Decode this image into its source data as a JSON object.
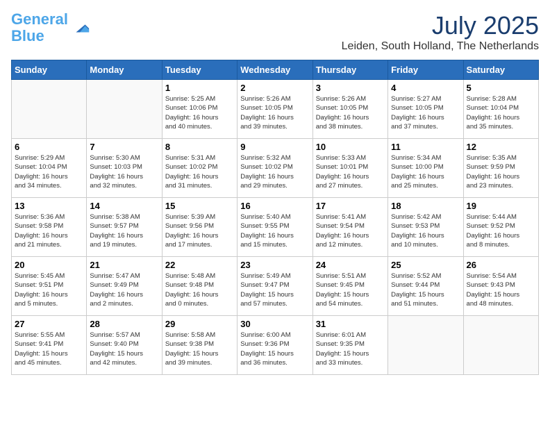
{
  "logo": {
    "line1": "General",
    "line2": "Blue"
  },
  "title": "July 2025",
  "location": "Leiden, South Holland, The Netherlands",
  "headers": [
    "Sunday",
    "Monday",
    "Tuesday",
    "Wednesday",
    "Thursday",
    "Friday",
    "Saturday"
  ],
  "weeks": [
    [
      {
        "day": "",
        "info": ""
      },
      {
        "day": "",
        "info": ""
      },
      {
        "day": "1",
        "info": "Sunrise: 5:25 AM\nSunset: 10:06 PM\nDaylight: 16 hours\nand 40 minutes."
      },
      {
        "day": "2",
        "info": "Sunrise: 5:26 AM\nSunset: 10:05 PM\nDaylight: 16 hours\nand 39 minutes."
      },
      {
        "day": "3",
        "info": "Sunrise: 5:26 AM\nSunset: 10:05 PM\nDaylight: 16 hours\nand 38 minutes."
      },
      {
        "day": "4",
        "info": "Sunrise: 5:27 AM\nSunset: 10:05 PM\nDaylight: 16 hours\nand 37 minutes."
      },
      {
        "day": "5",
        "info": "Sunrise: 5:28 AM\nSunset: 10:04 PM\nDaylight: 16 hours\nand 35 minutes."
      }
    ],
    [
      {
        "day": "6",
        "info": "Sunrise: 5:29 AM\nSunset: 10:04 PM\nDaylight: 16 hours\nand 34 minutes."
      },
      {
        "day": "7",
        "info": "Sunrise: 5:30 AM\nSunset: 10:03 PM\nDaylight: 16 hours\nand 32 minutes."
      },
      {
        "day": "8",
        "info": "Sunrise: 5:31 AM\nSunset: 10:02 PM\nDaylight: 16 hours\nand 31 minutes."
      },
      {
        "day": "9",
        "info": "Sunrise: 5:32 AM\nSunset: 10:02 PM\nDaylight: 16 hours\nand 29 minutes."
      },
      {
        "day": "10",
        "info": "Sunrise: 5:33 AM\nSunset: 10:01 PM\nDaylight: 16 hours\nand 27 minutes."
      },
      {
        "day": "11",
        "info": "Sunrise: 5:34 AM\nSunset: 10:00 PM\nDaylight: 16 hours\nand 25 minutes."
      },
      {
        "day": "12",
        "info": "Sunrise: 5:35 AM\nSunset: 9:59 PM\nDaylight: 16 hours\nand 23 minutes."
      }
    ],
    [
      {
        "day": "13",
        "info": "Sunrise: 5:36 AM\nSunset: 9:58 PM\nDaylight: 16 hours\nand 21 minutes."
      },
      {
        "day": "14",
        "info": "Sunrise: 5:38 AM\nSunset: 9:57 PM\nDaylight: 16 hours\nand 19 minutes."
      },
      {
        "day": "15",
        "info": "Sunrise: 5:39 AM\nSunset: 9:56 PM\nDaylight: 16 hours\nand 17 minutes."
      },
      {
        "day": "16",
        "info": "Sunrise: 5:40 AM\nSunset: 9:55 PM\nDaylight: 16 hours\nand 15 minutes."
      },
      {
        "day": "17",
        "info": "Sunrise: 5:41 AM\nSunset: 9:54 PM\nDaylight: 16 hours\nand 12 minutes."
      },
      {
        "day": "18",
        "info": "Sunrise: 5:42 AM\nSunset: 9:53 PM\nDaylight: 16 hours\nand 10 minutes."
      },
      {
        "day": "19",
        "info": "Sunrise: 5:44 AM\nSunset: 9:52 PM\nDaylight: 16 hours\nand 8 minutes."
      }
    ],
    [
      {
        "day": "20",
        "info": "Sunrise: 5:45 AM\nSunset: 9:51 PM\nDaylight: 16 hours\nand 5 minutes."
      },
      {
        "day": "21",
        "info": "Sunrise: 5:47 AM\nSunset: 9:49 PM\nDaylight: 16 hours\nand 2 minutes."
      },
      {
        "day": "22",
        "info": "Sunrise: 5:48 AM\nSunset: 9:48 PM\nDaylight: 16 hours\nand 0 minutes."
      },
      {
        "day": "23",
        "info": "Sunrise: 5:49 AM\nSunset: 9:47 PM\nDaylight: 15 hours\nand 57 minutes."
      },
      {
        "day": "24",
        "info": "Sunrise: 5:51 AM\nSunset: 9:45 PM\nDaylight: 15 hours\nand 54 minutes."
      },
      {
        "day": "25",
        "info": "Sunrise: 5:52 AM\nSunset: 9:44 PM\nDaylight: 15 hours\nand 51 minutes."
      },
      {
        "day": "26",
        "info": "Sunrise: 5:54 AM\nSunset: 9:43 PM\nDaylight: 15 hours\nand 48 minutes."
      }
    ],
    [
      {
        "day": "27",
        "info": "Sunrise: 5:55 AM\nSunset: 9:41 PM\nDaylight: 15 hours\nand 45 minutes."
      },
      {
        "day": "28",
        "info": "Sunrise: 5:57 AM\nSunset: 9:40 PM\nDaylight: 15 hours\nand 42 minutes."
      },
      {
        "day": "29",
        "info": "Sunrise: 5:58 AM\nSunset: 9:38 PM\nDaylight: 15 hours\nand 39 minutes."
      },
      {
        "day": "30",
        "info": "Sunrise: 6:00 AM\nSunset: 9:36 PM\nDaylight: 15 hours\nand 36 minutes."
      },
      {
        "day": "31",
        "info": "Sunrise: 6:01 AM\nSunset: 9:35 PM\nDaylight: 15 hours\nand 33 minutes."
      },
      {
        "day": "",
        "info": ""
      },
      {
        "day": "",
        "info": ""
      }
    ]
  ]
}
